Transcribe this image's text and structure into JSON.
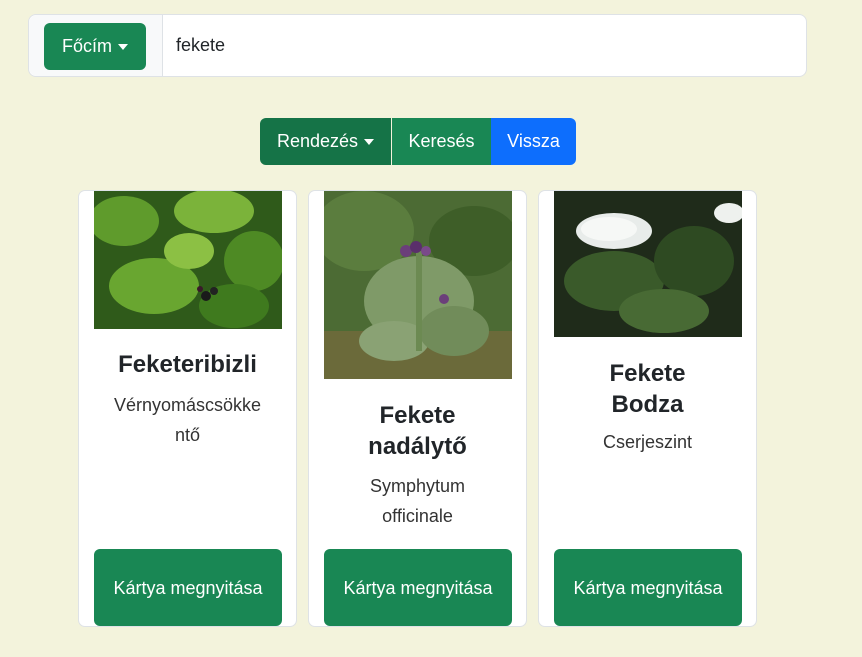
{
  "search": {
    "field_button": "Főcím",
    "query": "fekete"
  },
  "toolbar": {
    "sort_label": "Rendezés",
    "search_label": "Keresés",
    "back_label": "Vissza"
  },
  "cards": [
    {
      "title": "Feketeribizli",
      "subtitle": "Vérnyomáscsökkentő",
      "button": "Kártya megnyitása",
      "image": "black-currant-photo"
    },
    {
      "title": "Fekete nadálytő",
      "subtitle": "Symphytum officinale",
      "button": "Kártya megnyitása",
      "image": "comfrey-photo"
    },
    {
      "title": "Fekete Bodza",
      "subtitle": "Cserjeszint",
      "button": "Kártya megnyitása",
      "image": "elderflower-photo"
    }
  ],
  "colors": {
    "background": "#f3f3dc",
    "primary_green": "#198754",
    "active_green": "#157347",
    "blue": "#0d6efd"
  }
}
